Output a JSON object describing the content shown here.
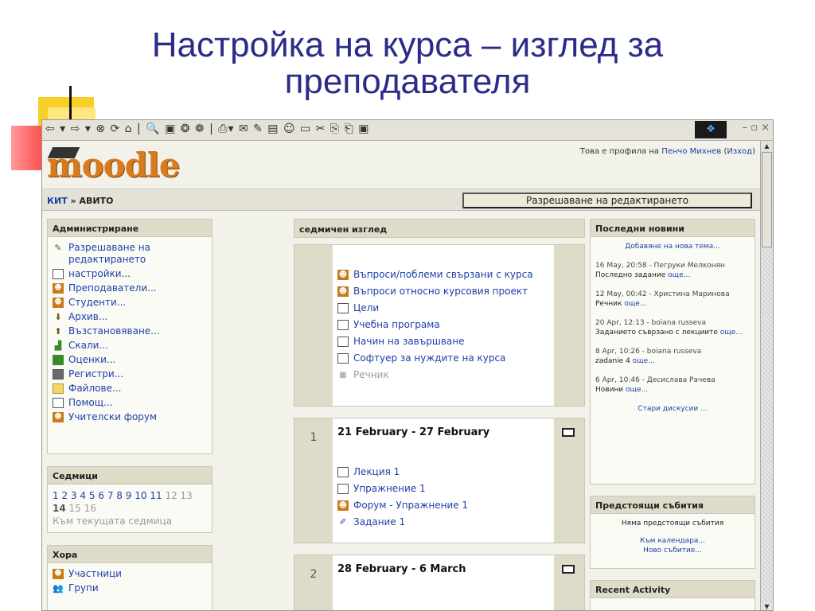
{
  "slide": {
    "title_line1": "Настройка на курса – изглед за",
    "title_line2": "преподавателя"
  },
  "browser": {
    "toolbar_icons": "⇦ ▾ ⇨ ▾ ⊗ ⟳ ⌂ | 🔍 ▣ ❂ ❁ | ⎙▾ ✉ ✎ ▤ ☺ ▭ ✂ ⎘ ⎗ ▣",
    "window_controls": "–  ▫  ×"
  },
  "moodle": {
    "logo_text": "moodle",
    "user_prefix": "Това е профила на",
    "user_name": "Пенчо Михнев",
    "logout_open": "(",
    "logout_label": "Изход",
    "logout_close": ")",
    "breadcrumb_root": "КИТ",
    "breadcrumb_sep": "»",
    "breadcrumb_current": "АВИТО",
    "edit_button_label": "Разрешаване на редактирането"
  },
  "admin_block": {
    "title": "Администриране",
    "items": [
      {
        "label": "Разрешаване на редактирането",
        "icon": "pencil-icon"
      },
      {
        "label": "настройки...",
        "icon": "document-icon"
      },
      {
        "label": "Преподаватели...",
        "icon": "teachers-icon"
      },
      {
        "label": "Студенти...",
        "icon": "students-icon"
      },
      {
        "label": "Архив...",
        "icon": "backup-icon"
      },
      {
        "label": "Възстановяване...",
        "icon": "restore-icon"
      },
      {
        "label": "Скали...",
        "icon": "scales-icon"
      },
      {
        "label": "Оценки...",
        "icon": "grades-icon"
      },
      {
        "label": "Регистри...",
        "icon": "logs-icon"
      },
      {
        "label": "Файлове...",
        "icon": "folder-icon"
      },
      {
        "label": "Помощ...",
        "icon": "help-icon"
      },
      {
        "label": "Учителски форум",
        "icon": "forum-icon"
      }
    ]
  },
  "weeks_block": {
    "title": "Седмици",
    "links": [
      "1",
      "2",
      "3",
      "4",
      "5",
      "6",
      "7",
      "8",
      "9",
      "10",
      "11"
    ],
    "future": [
      "12",
      "13"
    ],
    "current": "14",
    "future2": [
      "15",
      "16"
    ],
    "footer": "Към текущата седмица"
  },
  "people_block": {
    "title": "Хора",
    "items": [
      {
        "label": "Участници",
        "icon": "participants-icon"
      },
      {
        "label": "Групи",
        "icon": "groups-icon"
      }
    ]
  },
  "center": {
    "header": "седмичен изглед",
    "top_section_items": [
      {
        "label": "Въпроси/поблеми свързани с курса",
        "icon": "forum-icon"
      },
      {
        "label": "Въпроси относно курсовия проект",
        "icon": "forum-icon"
      },
      {
        "label": "Цели",
        "icon": "document-icon"
      },
      {
        "label": "Учебна програма",
        "icon": "document-icon"
      },
      {
        "label": "Начин на завършване",
        "icon": "document-icon"
      },
      {
        "label": "Софтуер за нуждите на курса",
        "icon": "document-icon"
      }
    ],
    "glossary_label": "Речник",
    "week1": {
      "number": "1",
      "title": "21 February - 27 February",
      "items": [
        {
          "label": "Лекция 1",
          "icon": "document-icon"
        },
        {
          "label": "Упражнение 1",
          "icon": "document-icon"
        },
        {
          "label": "Форум - Упражнение 1",
          "icon": "forum-icon"
        },
        {
          "label": "Задание 1",
          "icon": "assignment-icon"
        }
      ]
    },
    "week2": {
      "number": "2",
      "title": "28 February - 6 March"
    }
  },
  "news_block": {
    "title": "Последни новини",
    "add_topic": "Добавяне на нова тема...",
    "items": [
      {
        "meta": "16 May, 20:58 - Пегруки Мелконян",
        "text": "Последно задание",
        "more": "още..."
      },
      {
        "meta": "12 May, 00:42 - Христина Маринова",
        "text": "Речник",
        "more": "още..."
      },
      {
        "meta": "20 Apr, 12:13 - boiana russeva",
        "text": "Заданието съврзано с лекциите",
        "more": "още..."
      },
      {
        "meta": "8 Apr, 10:26 - boiana russeva",
        "text": "zadanie 4",
        "more": "още..."
      },
      {
        "meta": "6 Apr, 10:46 - Десислава Рачева",
        "text": "Новини",
        "more": "още..."
      }
    ],
    "old_topics": "Стари дискусии ..."
  },
  "events_block": {
    "title": "Предстоящи събития",
    "none": "Няма предстоящи събития",
    "calendar_link": "Към календара...",
    "new_event_link": "Ново събитие..."
  },
  "activity_block": {
    "title": "Recent Activity"
  },
  "colors": {
    "title_blue": "#2b2b8a",
    "link_blue": "#1c3fa8",
    "moodle_orange": "#d87b1d",
    "block_header": "#dedbc9"
  }
}
